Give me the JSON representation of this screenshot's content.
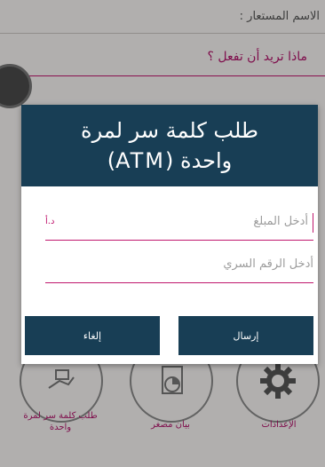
{
  "background": {
    "alias_label": "الاسم المستعار :",
    "prompt": "ماذا تريد أن تفعل ؟",
    "tiles": [
      {
        "label": "طلب كلمة سر لمرة واحدة"
      },
      {
        "label": "بيان مصغر"
      },
      {
        "label": "الإعدادات"
      }
    ]
  },
  "dialog": {
    "title": "طلب كلمة سر لمرة\nواحدة (ATM)",
    "amount_placeholder": "أدخل المبلغ",
    "currency": "د.أ",
    "pin_placeholder": "أدخل الرقم السري",
    "send_label": "إرسال",
    "cancel_label": "إلغاء"
  },
  "colors": {
    "header": "#183e55",
    "accent": "#c0176e"
  }
}
